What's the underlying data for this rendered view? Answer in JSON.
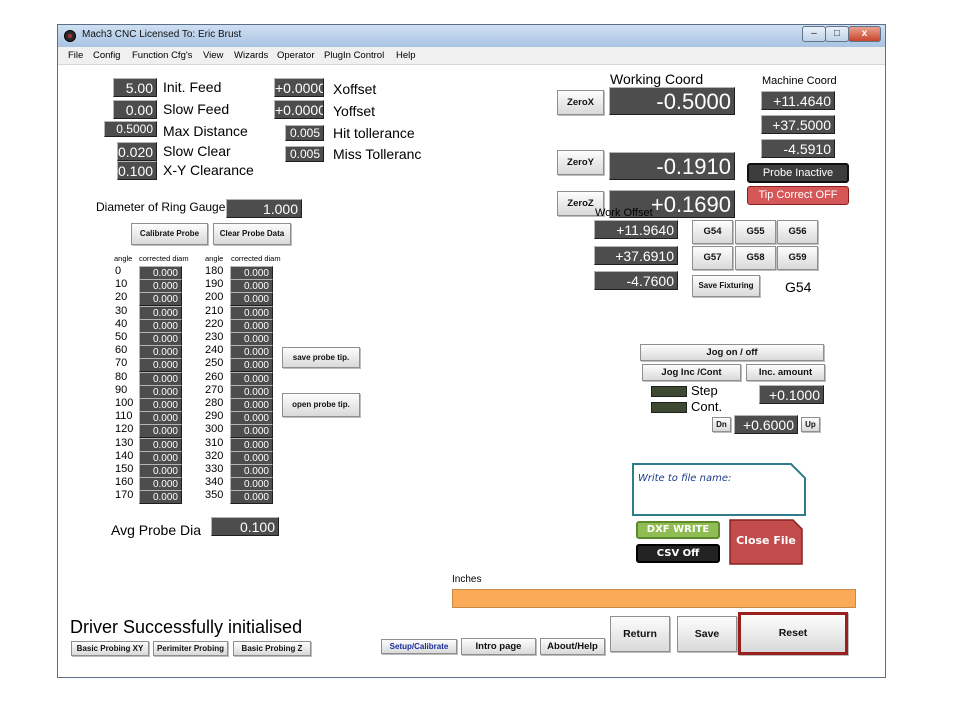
{
  "window": {
    "title": "Mach3 CNC  Licensed To: Eric Brust",
    "controls": {
      "minimize": "–",
      "maximize": "□",
      "close": "x"
    }
  },
  "menu": [
    "File",
    "Config",
    "Function Cfg's",
    "View",
    "Wizards",
    "Operator",
    "PlugIn Control",
    "Help"
  ],
  "params_left": [
    {
      "value": "5.00",
      "label": "Init. Feed"
    },
    {
      "value": "0.00",
      "label": "Slow Feed"
    },
    {
      "value": "0.5000",
      "label": "Max Distance"
    },
    {
      "value": "0.020",
      "label": "Slow Clear"
    },
    {
      "value": "0.100",
      "label": "X-Y Clearance"
    }
  ],
  "params_right": [
    {
      "value": "+0.0000",
      "label": "Xoffset"
    },
    {
      "value": "+0.0000",
      "label": "Yoffset"
    },
    {
      "value": "0.005",
      "label": "Hit tollerance"
    },
    {
      "value": "0.005",
      "label": "Miss Tolleranc"
    }
  ],
  "ring_gauge": {
    "label": "Diameter of Ring Gauge",
    "value": "1.000"
  },
  "probe_buttons": {
    "calibrate": "Calibrate Probe",
    "clear": "Clear Probe Data",
    "save_tip": "save probe tip.",
    "open_tip": "open probe tip."
  },
  "angle_table": {
    "header_angle": "angle",
    "header_diam": "corrected diam",
    "col1": [
      {
        "angle": "0",
        "diam": "0.000"
      },
      {
        "angle": "10",
        "diam": "0.000"
      },
      {
        "angle": "20",
        "diam": "0.000"
      },
      {
        "angle": "30",
        "diam": "0.000"
      },
      {
        "angle": "40",
        "diam": "0.000"
      },
      {
        "angle": "50",
        "diam": "0.000"
      },
      {
        "angle": "60",
        "diam": "0.000"
      },
      {
        "angle": "70",
        "diam": "0.000"
      },
      {
        "angle": "80",
        "diam": "0.000"
      },
      {
        "angle": "90",
        "diam": "0.000"
      },
      {
        "angle": "100",
        "diam": "0.000"
      },
      {
        "angle": "110",
        "diam": "0.000"
      },
      {
        "angle": "120",
        "diam": "0.000"
      },
      {
        "angle": "130",
        "diam": "0.000"
      },
      {
        "angle": "140",
        "diam": "0.000"
      },
      {
        "angle": "150",
        "diam": "0.000"
      },
      {
        "angle": "160",
        "diam": "0.000"
      },
      {
        "angle": "170",
        "diam": "0.000"
      }
    ],
    "col2": [
      {
        "angle": "180",
        "diam": "0.000"
      },
      {
        "angle": "190",
        "diam": "0.000"
      },
      {
        "angle": "200",
        "diam": "0.000"
      },
      {
        "angle": "210",
        "diam": "0.000"
      },
      {
        "angle": "220",
        "diam": "0.000"
      },
      {
        "angle": "230",
        "diam": "0.000"
      },
      {
        "angle": "240",
        "diam": "0.000"
      },
      {
        "angle": "250",
        "diam": "0.000"
      },
      {
        "angle": "260",
        "diam": "0.000"
      },
      {
        "angle": "270",
        "diam": "0.000"
      },
      {
        "angle": "280",
        "diam": "0.000"
      },
      {
        "angle": "290",
        "diam": "0.000"
      },
      {
        "angle": "300",
        "diam": "0.000"
      },
      {
        "angle": "310",
        "diam": "0.000"
      },
      {
        "angle": "320",
        "diam": "0.000"
      },
      {
        "angle": "330",
        "diam": "0.000"
      },
      {
        "angle": "340",
        "diam": "0.000"
      },
      {
        "angle": "350",
        "diam": "0.000"
      }
    ]
  },
  "avg_probe": {
    "label": "Avg Probe Dia",
    "value": "0.100"
  },
  "working_coord": {
    "label": "Working Coord",
    "axes": [
      {
        "button": "ZeroX",
        "value": "-0.5000"
      },
      {
        "button": "ZeroY",
        "value": "-0.1910"
      },
      {
        "button": "ZeroZ",
        "value": "+0.1690"
      }
    ]
  },
  "machine_coord": {
    "label": "Machine Coord",
    "values": [
      "+11.4640",
      "+37.5000",
      "-4.5910"
    ]
  },
  "probe_status": "Probe Inactive",
  "tip_correct": "Tip Correct OFF",
  "work_offset": {
    "label": "Work Offset",
    "values": [
      "+11.9640",
      "+37.6910",
      "-4.7600"
    ]
  },
  "fixtures": {
    "buttons": [
      "G54",
      "G55",
      "G56",
      "G57",
      "G58",
      "G59"
    ],
    "save": "Save Fixturing",
    "current": "G54"
  },
  "jog": {
    "on_off": "Jog on / off",
    "inc_cont": "Jog Inc /Cont",
    "inc_amount": "Inc. amount",
    "step": "Step",
    "cont": "Cont.",
    "inc_value": "+0.1000",
    "dn": "Dn",
    "rate_value": "+0.6000",
    "up": "Up"
  },
  "file": {
    "label": "Write to file name:",
    "dxf": "DXF WRITE",
    "csv": "CSV Off",
    "close": "Close File"
  },
  "units": "Inches",
  "status": "Driver Successfully initialised",
  "bottom_tabs": {
    "basic_xy": "Basic Probing XY",
    "perimeter": "Perimiter Probing",
    "basic_z": "Basic Probing Z",
    "setup": "Setup/Calibrate",
    "intro": "Intro page",
    "about": "About/Help"
  },
  "actions": {
    "return": "Return",
    "save": "Save",
    "reset": "Reset"
  },
  "colors": {
    "dro_bg": "#4d4d4d",
    "progress": "#fbaa58",
    "file_frame": "#2f7d8a",
    "close_file": "#c24c4c",
    "reset_border": "#9a1f1f"
  }
}
